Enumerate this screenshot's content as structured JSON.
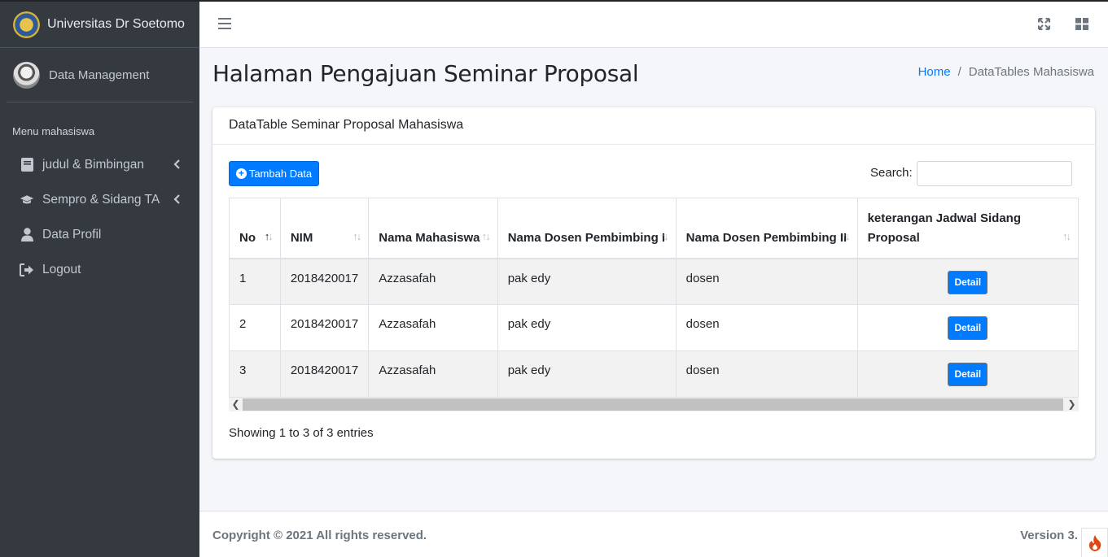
{
  "sidebar": {
    "brand": "Universitas Dr Soetomo",
    "user": "Data Management",
    "header": "Menu mahasiswa",
    "items": [
      {
        "label": "judul & Bimbingan"
      },
      {
        "label": "Sempro & Sidang TA"
      },
      {
        "label": "Data Profil"
      },
      {
        "label": "Logout"
      }
    ]
  },
  "content": {
    "title": "Halaman Pengajuan Seminar Proposal",
    "breadcrumb": {
      "home": "Home",
      "current": "DataTables Mahasiswa"
    }
  },
  "card": {
    "title": "DataTable Seminar Proposal Mahasiswa",
    "add_button": "Tambah Data",
    "search_label": "Search:",
    "search_value": "",
    "columns": [
      "No",
      "NIM",
      "Nama Mahasiswa",
      "Nama Dosen Pembimbing I",
      "Nama Dosen Pembimbing II",
      "keterangan Jadwal Sidang Proposal"
    ],
    "rows": [
      {
        "no": "1",
        "nim": "2018420017",
        "nama": "Azzasafah",
        "dosen1": "pak edy",
        "dosen2": "dosen",
        "action": "Detail"
      },
      {
        "no": "2",
        "nim": "2018420017",
        "nama": "Azzasafah",
        "dosen1": "pak edy",
        "dosen2": "dosen",
        "action": "Detail"
      },
      {
        "no": "3",
        "nim": "2018420017",
        "nama": "Azzasafah",
        "dosen1": "pak edy",
        "dosen2": "dosen",
        "action": "Detail"
      }
    ],
    "info": "Showing 1 to 3 of 3 entries"
  },
  "footer": {
    "copyright": "Copyright © 2021 All rights reserved.",
    "version": "Version 3."
  },
  "colors": {
    "primary": "#007bff",
    "sidebar": "#343a40"
  }
}
